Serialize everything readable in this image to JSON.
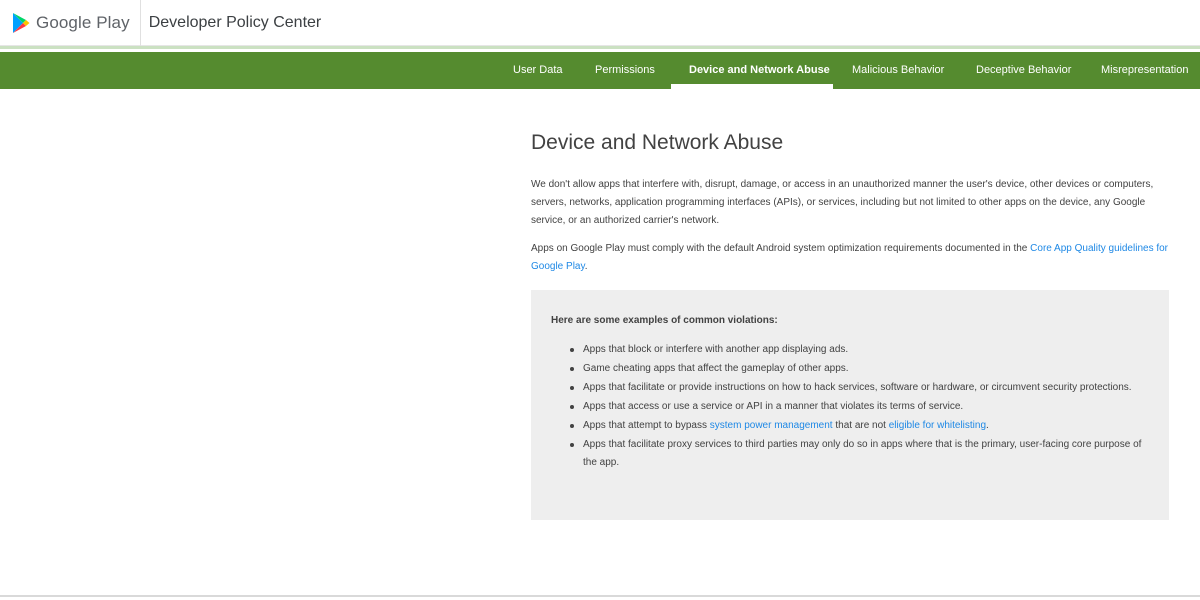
{
  "header": {
    "brand": "Google Play",
    "app_title": "Developer Policy Center",
    "logo_icon": "google-play-logo-icon"
  },
  "nav": {
    "items": [
      {
        "label": "User Data",
        "active": false
      },
      {
        "label": "Permissions",
        "active": false
      },
      {
        "label": "Device and Network Abuse",
        "active": true
      },
      {
        "label": "Malicious Behavior",
        "active": false
      },
      {
        "label": "Deceptive Behavior",
        "active": false
      },
      {
        "label": "Misrepresentation",
        "active": false
      }
    ],
    "background_color": "#558b2f"
  },
  "main": {
    "heading": "Device and Network Abuse",
    "paragraph1": "We don't allow apps that interfere with, disrupt, damage, or access in an unauthorized manner the user's device, other devices or computers, servers, networks, application programming interfaces (APIs), or services, including but not limited to other apps on the device, any Google service, or an authorized carrier's network.",
    "paragraph2_before": "Apps on Google Play must comply with the default Android system optimization requirements documented in the ",
    "paragraph2_link": "Core App Quality guidelines for Google Play",
    "paragraph2_after": ".",
    "examples": {
      "title": "Here are some examples of common violations:",
      "item1": "Apps that block or interfere with another app displaying ads.",
      "item2": "Game cheating apps that affect the gameplay of other apps.",
      "item3": "Apps that facilitate or provide instructions on how to hack services, software or hardware, or circumvent security protections.",
      "item4": "Apps that access or use a service or API in a manner that violates its terms of service.",
      "item5_before": "Apps that attempt to bypass ",
      "item5_link1": "system power management",
      "item5_middle": " that are not ",
      "item5_link2": "eligible for whitelisting",
      "item5_after": ".",
      "item6": "Apps that facilitate proxy services to third parties may only do so in apps where that is the primary, user-facing core purpose of the app."
    },
    "link_color": "#1e88e5",
    "box_color": "#eeeeee"
  }
}
